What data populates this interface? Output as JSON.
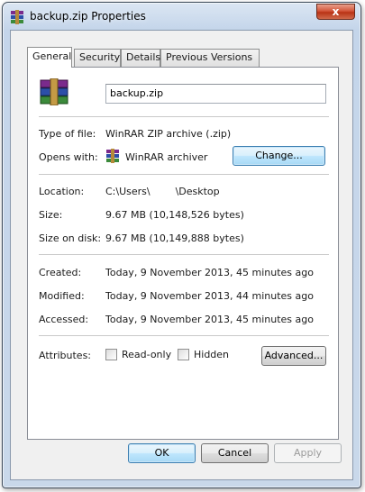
{
  "window": {
    "title": "backup.zip Properties",
    "close_glyph": "x"
  },
  "tabs": [
    {
      "label": "General",
      "active": true
    },
    {
      "label": "Security"
    },
    {
      "label": "Details"
    },
    {
      "label": "Previous Versions"
    }
  ],
  "general": {
    "file_name": "backup.zip",
    "type_label": "Type of file:",
    "type_value": "WinRAR ZIP archive (.zip)",
    "opens_label": "Opens with:",
    "opens_value": "WinRAR archiver",
    "change_button": "Change...",
    "location_label": "Location:",
    "location_value": "C:\\Users\\        \\Desktop",
    "size_label": "Size:",
    "size_value": "9.67 MB (10,148,526 bytes)",
    "size_on_disk_label": "Size on disk:",
    "size_on_disk_value": "9.67 MB (10,149,888 bytes)",
    "created_label": "Created:",
    "created_value": "Today, 9 November 2013, 45 minutes ago",
    "modified_label": "Modified:",
    "modified_value": "Today, 9 November 2013, 44 minutes ago",
    "accessed_label": "Accessed:",
    "accessed_value": "Today, 9 November 2013, 45 minutes ago",
    "attributes_label": "Attributes:",
    "readonly_label": "Read-only",
    "hidden_label": "Hidden",
    "advanced_button": "Advanced..."
  },
  "footer": {
    "ok": "OK",
    "cancel": "Cancel",
    "apply": "Apply"
  },
  "icons": {
    "app": "winrar-archive-icon"
  }
}
